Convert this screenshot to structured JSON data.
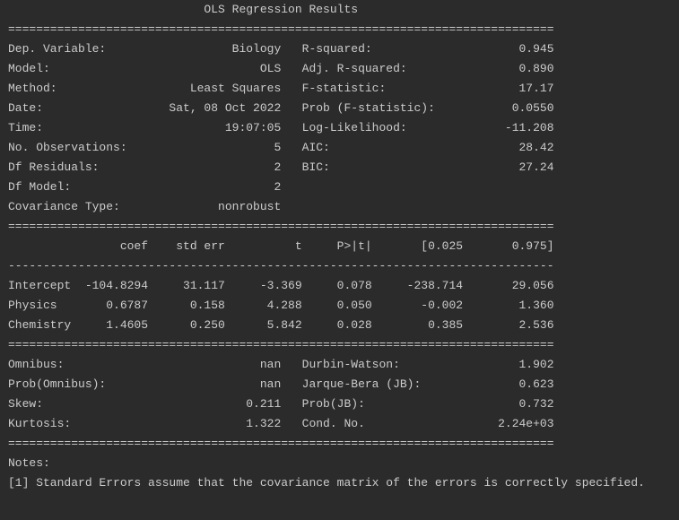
{
  "title": "OLS Regression Results",
  "dep_variable_label": "Dep. Variable:",
  "dep_variable": "Biology",
  "model_label": "Model:",
  "model": "OLS",
  "method_label": "Method:",
  "method": "Least Squares",
  "date_label": "Date:",
  "date": "Sat, 08 Oct 2022",
  "time_label": "Time:",
  "time": "19:07:05",
  "nobs_label": "No. Observations:",
  "nobs": "5",
  "df_resid_label": "Df Residuals:",
  "df_resid": "2",
  "df_model_label": "Df Model:",
  "df_model": "2",
  "cov_type_label": "Covariance Type:",
  "cov_type": "nonrobust",
  "rsq_label": "R-squared:",
  "rsq": "0.945",
  "arsq_label": "Adj. R-squared:",
  "arsq": "0.890",
  "fstat_label": "F-statistic:",
  "fstat": "17.17",
  "pfs_label": "Prob (F-statistic):",
  "pfs": "0.0550",
  "llh_label": "Log-Likelihood:",
  "llh": "-11.208",
  "aic_label": "AIC:",
  "aic": "28.42",
  "bic_label": "BIC:",
  "bic": "27.24",
  "coef_hdr_coef": "coef",
  "coef_hdr_stderr": "std err",
  "coef_hdr_t": "t",
  "coef_hdr_p": "P>|t|",
  "coef_hdr_lo": "[0.025",
  "coef_hdr_hi": "0.975]",
  "rows": [
    {
      "name": "Intercept",
      "coef": "-104.8294",
      "stderr": "31.117",
      "t": "-3.369",
      "p": "0.078",
      "lo": "-238.714",
      "hi": "29.056"
    },
    {
      "name": "Physics",
      "coef": "0.6787",
      "stderr": "0.158",
      "t": "4.288",
      "p": "0.050",
      "lo": "-0.002",
      "hi": "1.360"
    },
    {
      "name": "Chemistry",
      "coef": "1.4605",
      "stderr": "0.250",
      "t": "5.842",
      "p": "0.028",
      "lo": "0.385",
      "hi": "2.536"
    }
  ],
  "omnibus_label": "Omnibus:",
  "omnibus": "nan",
  "dw_label": "Durbin-Watson:",
  "dw": "1.902",
  "pomni_label": "Prob(Omnibus):",
  "pomni": "nan",
  "jb_label": "Jarque-Bera (JB):",
  "jb": "0.623",
  "skew_label": "Skew:",
  "skew": "0.211",
  "pjb_label": "Prob(JB):",
  "pjb": "0.732",
  "kurt_label": "Kurtosis:",
  "kurt": "1.322",
  "cond_label": "Cond. No.",
  "cond": "2.24e+03",
  "notes_heading": "Notes:",
  "notes_1": "[1] Standard Errors assume that the covariance matrix of the errors is correctly specified."
}
